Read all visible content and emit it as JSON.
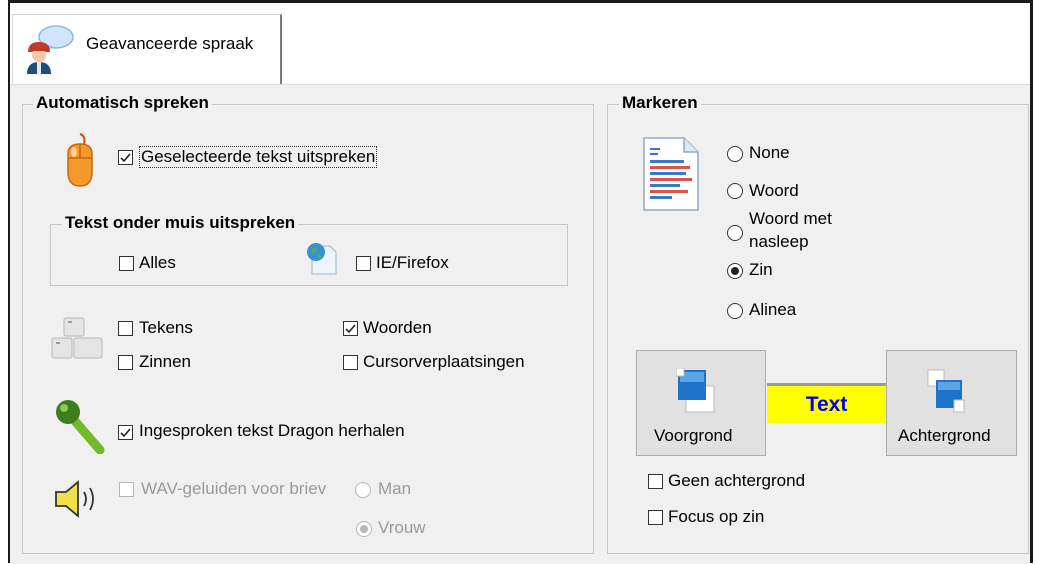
{
  "tab": {
    "label": "Geavanceerde spraak"
  },
  "auto": {
    "legend": "Automatisch spreken",
    "selected_text": {
      "label": "Geselecteerde tekst uitspreken",
      "checked": true
    },
    "under_mouse": {
      "legend": "Tekst onder muis uitspreken",
      "alles": {
        "label": "Alles",
        "checked": false
      },
      "iefirefox": {
        "label": "IE/Firefox",
        "checked": false
      }
    },
    "tekens": {
      "label": "Tekens",
      "checked": false
    },
    "woorden": {
      "label": "Woorden",
      "checked": true
    },
    "zinnen": {
      "label": "Zinnen",
      "checked": false
    },
    "cursor": {
      "label": "Cursorverplaatsingen",
      "checked": false
    },
    "dragon": {
      "label": "Ingesproken tekst Dragon herhalen",
      "checked": true
    },
    "wav": {
      "label": "WAV-geluiden voor briev",
      "checked": false,
      "enabled": false
    },
    "voice": {
      "man": "Man",
      "vrouw": "Vrouw",
      "selected": "Vrouw"
    }
  },
  "mark": {
    "legend": "Markeren",
    "options": {
      "none": "None",
      "woord": "Woord",
      "woord_met_1": "Woord met",
      "woord_met_2": "nasleep",
      "zin": "Zin",
      "alinea": "Alinea"
    },
    "selected": "Zin",
    "voorgrond": "Voorgrond",
    "achtergrond": "Achtergrond",
    "preview_text": "Text",
    "preview_fg": "#0000ff",
    "preview_bg": "#ffff00",
    "geen_achtergrond": {
      "label": "Geen achtergrond",
      "checked": false
    },
    "focus_op_zin": {
      "label": "Focus op zin",
      "checked": false
    }
  }
}
